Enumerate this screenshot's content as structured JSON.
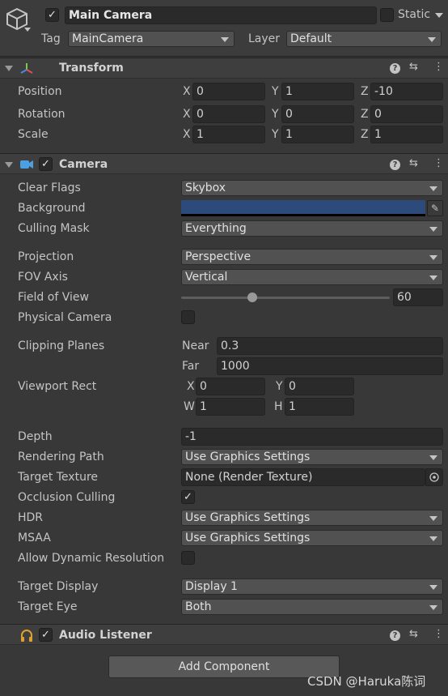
{
  "header": {
    "name": "Main Camera",
    "static_label": "Static",
    "tag_label": "Tag",
    "tag_value": "MainCamera",
    "layer_label": "Layer",
    "layer_value": "Default"
  },
  "transform": {
    "title": "Transform",
    "position": {
      "label": "Position",
      "x": "0",
      "y": "1",
      "z": "-10"
    },
    "rotation": {
      "label": "Rotation",
      "x": "0",
      "y": "0",
      "z": "0"
    },
    "scale": {
      "label": "Scale",
      "x": "1",
      "y": "1",
      "z": "1"
    },
    "axis_x": "X",
    "axis_y": "Y",
    "axis_z": "Z"
  },
  "camera": {
    "title": "Camera",
    "clear_flags": {
      "label": "Clear Flags",
      "value": "Skybox"
    },
    "background": {
      "label": "Background",
      "color": "#2c4a7a"
    },
    "culling_mask": {
      "label": "Culling Mask",
      "value": "Everything"
    },
    "projection": {
      "label": "Projection",
      "value": "Perspective"
    },
    "fov_axis": {
      "label": "FOV Axis",
      "value": "Vertical"
    },
    "field_of_view": {
      "label": "Field of View",
      "value": "60",
      "slider_fraction": 0.34
    },
    "physical_camera": {
      "label": "Physical Camera"
    },
    "clipping_planes": {
      "label": "Clipping Planes",
      "near_label": "Near",
      "near": "0.3",
      "far_label": "Far",
      "far": "1000"
    },
    "viewport_rect": {
      "label": "Viewport Rect",
      "x_label": "X",
      "x": "0",
      "y_label": "Y",
      "y": "0",
      "w_label": "W",
      "w": "1",
      "h_label": "H",
      "h": "1"
    },
    "depth": {
      "label": "Depth",
      "value": "-1"
    },
    "rendering_path": {
      "label": "Rendering Path",
      "value": "Use Graphics Settings"
    },
    "target_texture": {
      "label": "Target Texture",
      "value": "None (Render Texture)"
    },
    "occlusion_culling": {
      "label": "Occlusion Culling",
      "check": "✓"
    },
    "hdr": {
      "label": "HDR",
      "value": "Use Graphics Settings"
    },
    "msaa": {
      "label": "MSAA",
      "value": "Use Graphics Settings"
    },
    "dynamic_resolution": {
      "label": "Allow Dynamic Resolution"
    },
    "target_display": {
      "label": "Target Display",
      "value": "Display 1"
    },
    "target_eye": {
      "label": "Target Eye",
      "value": "Both"
    }
  },
  "audio_listener": {
    "title": "Audio Listener"
  },
  "add_component": "Add Component",
  "check_glyph": "✓",
  "help_glyph": "?",
  "watermark": "CSDN @Haruka陈词"
}
